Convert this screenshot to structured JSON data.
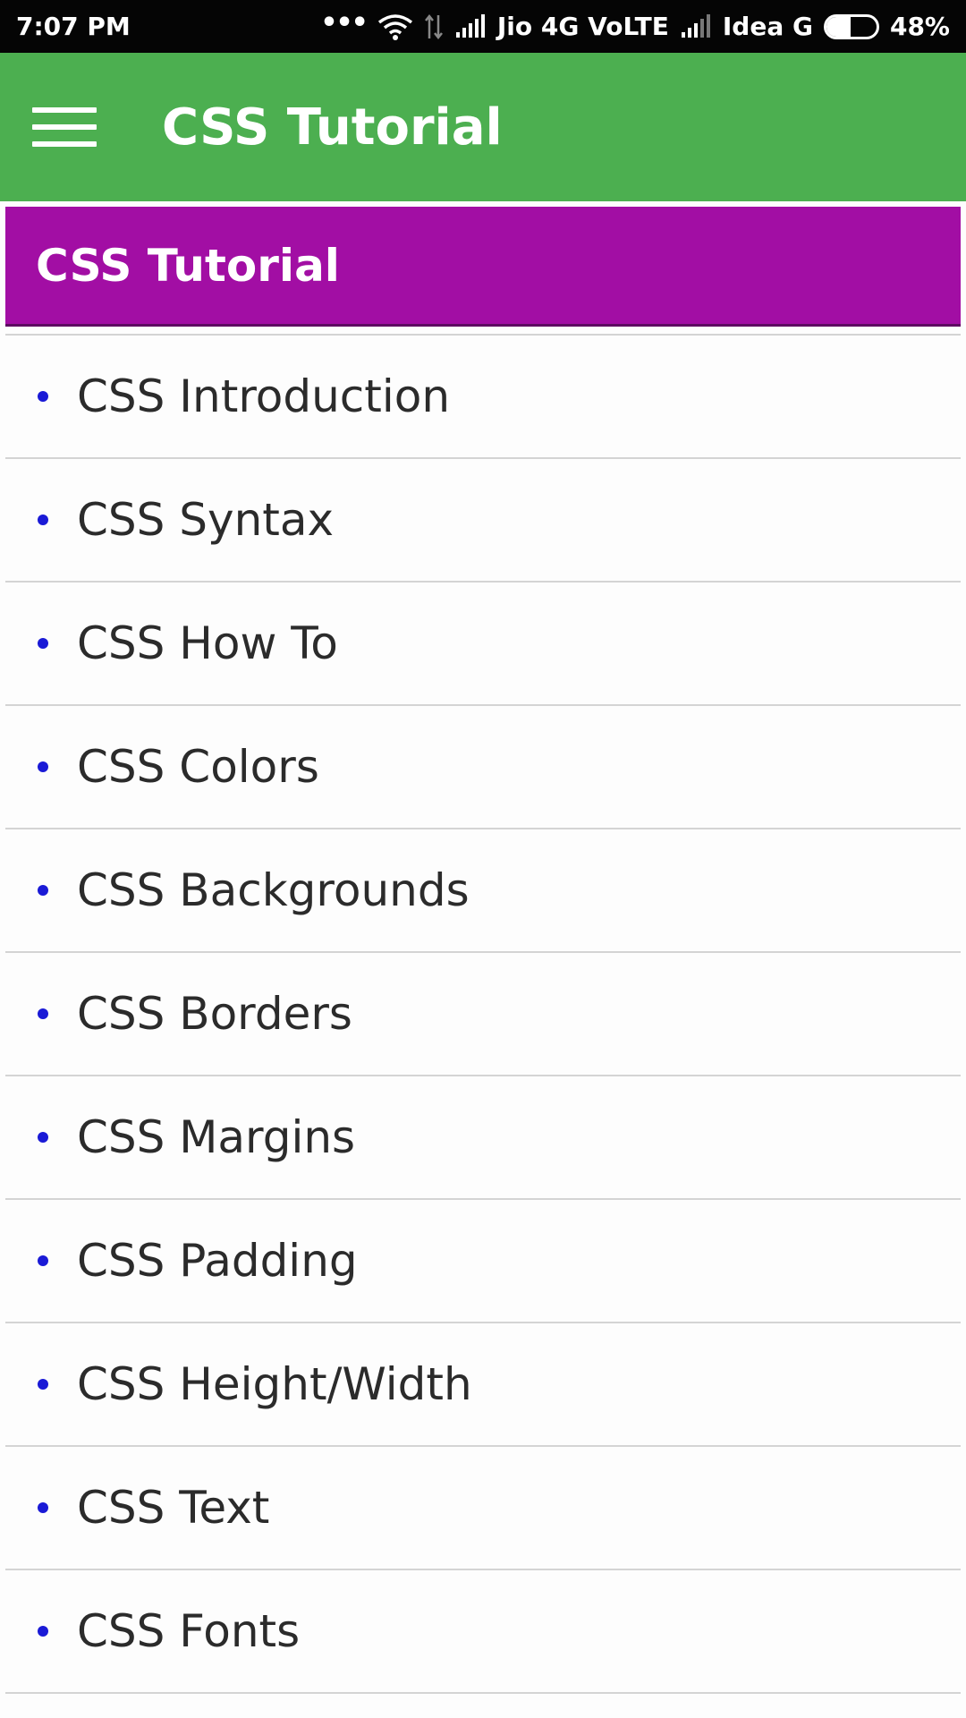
{
  "status_bar": {
    "time": "7:07 PM",
    "more_icon": "more-dots-icon",
    "wifi_icon": "wifi-icon",
    "data_icon": "data-transfer-icon",
    "carrier1_signal_icon": "signal-icon",
    "carrier1": "Jio 4G VoLTE",
    "carrier2_signal_icon": "signal-icon",
    "carrier2": "Idea G",
    "battery_icon": "battery-icon",
    "battery_level": 0.48,
    "battery_percent": "48%"
  },
  "app_bar": {
    "menu_icon": "hamburger-menu-icon",
    "title": "CSS Tutorial",
    "color": "#4caf50"
  },
  "section": {
    "title": "CSS Tutorial",
    "color": "#a20ea4"
  },
  "topics": [
    {
      "label": "CSS Introduction"
    },
    {
      "label": "CSS Syntax"
    },
    {
      "label": "CSS How To"
    },
    {
      "label": "CSS Colors"
    },
    {
      "label": "CSS Backgrounds"
    },
    {
      "label": "CSS Borders"
    },
    {
      "label": "CSS Margins"
    },
    {
      "label": "CSS Padding"
    },
    {
      "label": "CSS Height/Width"
    },
    {
      "label": "CSS Text"
    },
    {
      "label": "CSS Fonts"
    }
  ],
  "bullet_color": "#1a1ad6"
}
